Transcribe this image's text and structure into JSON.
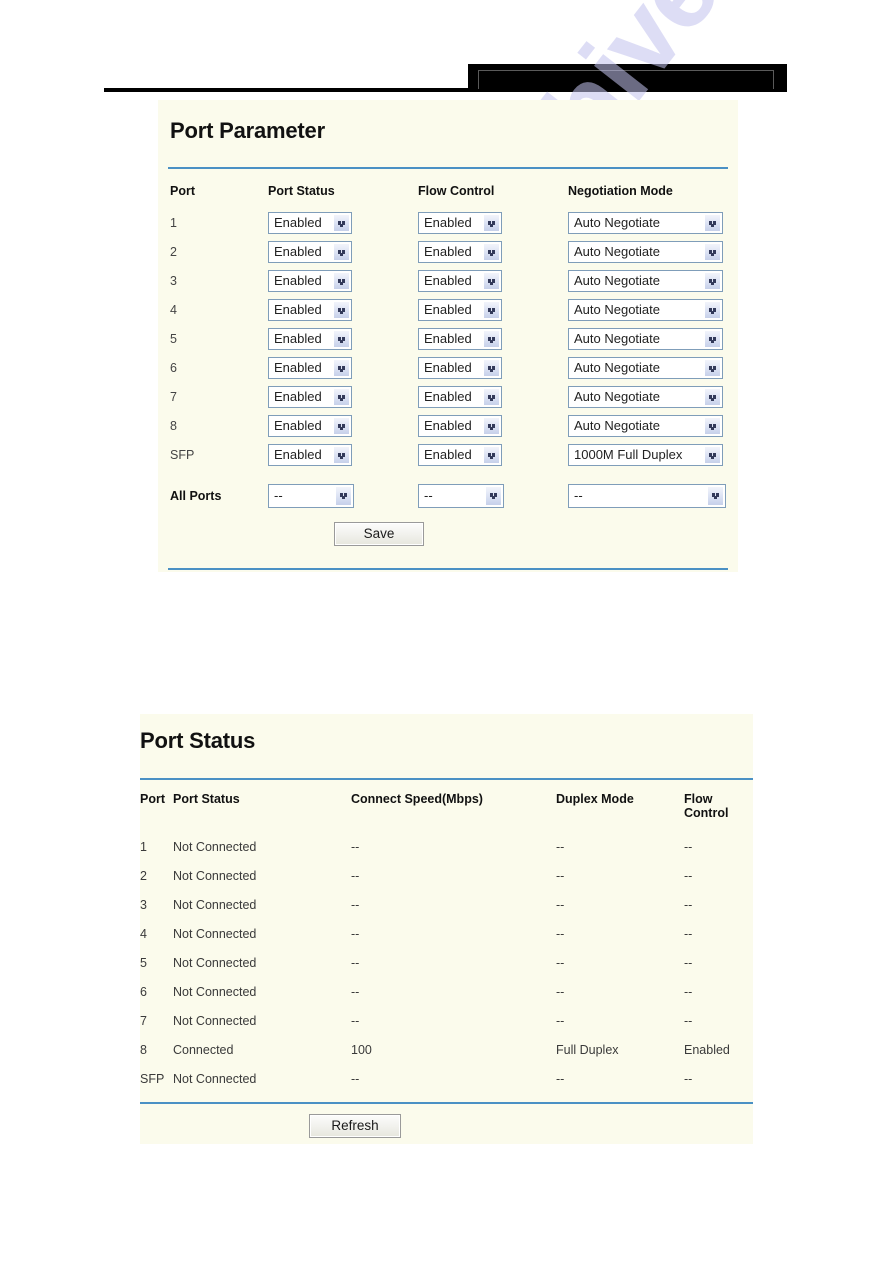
{
  "header": {
    "black_box_label": ""
  },
  "watermark": {
    "text": "manualshive.com"
  },
  "port_parameter": {
    "title": "Port Parameter",
    "columns": {
      "port": "Port",
      "port_status": "Port Status",
      "flow_control": "Flow Control",
      "negotiation_mode": "Negotiation Mode"
    },
    "rows": [
      {
        "port": "1",
        "port_status": "Enabled",
        "flow_control": "Enabled",
        "negotiation_mode": "Auto Negotiate"
      },
      {
        "port": "2",
        "port_status": "Enabled",
        "flow_control": "Enabled",
        "negotiation_mode": "Auto Negotiate"
      },
      {
        "port": "3",
        "port_status": "Enabled",
        "flow_control": "Enabled",
        "negotiation_mode": "Auto Negotiate"
      },
      {
        "port": "4",
        "port_status": "Enabled",
        "flow_control": "Enabled",
        "negotiation_mode": "Auto Negotiate"
      },
      {
        "port": "5",
        "port_status": "Enabled",
        "flow_control": "Enabled",
        "negotiation_mode": "Auto Negotiate"
      },
      {
        "port": "6",
        "port_status": "Enabled",
        "flow_control": "Enabled",
        "negotiation_mode": "Auto Negotiate"
      },
      {
        "port": "7",
        "port_status": "Enabled",
        "flow_control": "Enabled",
        "negotiation_mode": "Auto Negotiate"
      },
      {
        "port": "8",
        "port_status": "Enabled",
        "flow_control": "Enabled",
        "negotiation_mode": "Auto Negotiate"
      },
      {
        "port": "SFP",
        "port_status": "Enabled",
        "flow_control": "Enabled",
        "negotiation_mode": "1000M Full Duplex"
      }
    ],
    "all_ports": {
      "label": "All Ports",
      "port_status": "--",
      "flow_control": "--",
      "negotiation_mode": "--"
    },
    "save_label": "Save"
  },
  "port_status": {
    "title": "Port Status",
    "columns": {
      "port": "Port",
      "port_status": "Port Status",
      "connect_speed": "Connect Speed(Mbps)",
      "duplex_mode": "Duplex Mode",
      "flow_control": "Flow Control"
    },
    "rows": [
      {
        "port": "1",
        "port_status": "Not Connected",
        "connect_speed": "--",
        "duplex_mode": "--",
        "flow_control": "--"
      },
      {
        "port": "2",
        "port_status": "Not Connected",
        "connect_speed": "--",
        "duplex_mode": "--",
        "flow_control": "--"
      },
      {
        "port": "3",
        "port_status": "Not Connected",
        "connect_speed": "--",
        "duplex_mode": "--",
        "flow_control": "--"
      },
      {
        "port": "4",
        "port_status": "Not Connected",
        "connect_speed": "--",
        "duplex_mode": "--",
        "flow_control": "--"
      },
      {
        "port": "5",
        "port_status": "Not Connected",
        "connect_speed": "--",
        "duplex_mode": "--",
        "flow_control": "--"
      },
      {
        "port": "6",
        "port_status": "Not Connected",
        "connect_speed": "--",
        "duplex_mode": "--",
        "flow_control": "--"
      },
      {
        "port": "7",
        "port_status": "Not Connected",
        "connect_speed": "--",
        "duplex_mode": "--",
        "flow_control": "--"
      },
      {
        "port": "8",
        "port_status": "Connected",
        "connect_speed": "100",
        "duplex_mode": "Full Duplex",
        "flow_control": "Enabled"
      },
      {
        "port": "SFP",
        "port_status": "Not Connected",
        "connect_speed": "--",
        "duplex_mode": "--",
        "flow_control": "--"
      }
    ],
    "refresh_label": "Refresh"
  },
  "colors": {
    "panel_bg": "#fbfbec",
    "rule_blue": "#4a90c4",
    "select_border": "#7f9db9",
    "watermark": "#c3c3ee"
  }
}
